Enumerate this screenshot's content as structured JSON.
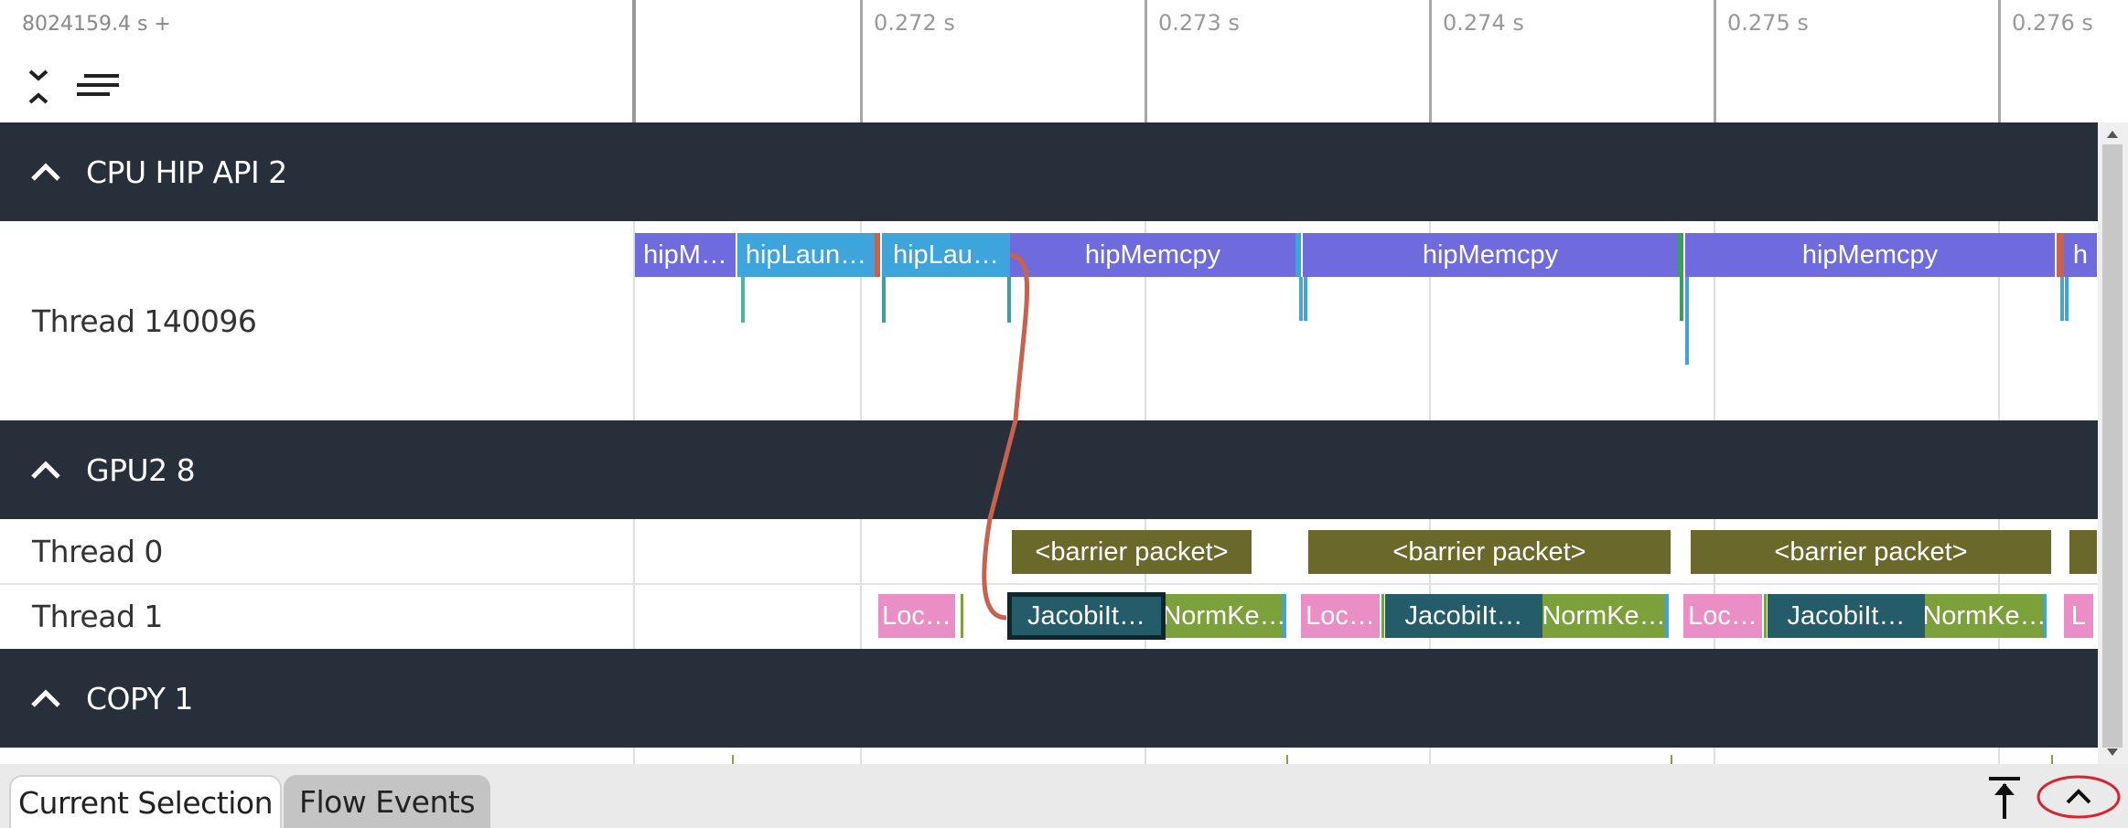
{
  "header": {
    "time_origin": "8024159.4 s +",
    "expand_collapse_icon": "expand-collapse-icon",
    "filter_icon": "lines-icon"
  },
  "ruler": {
    "ticks": [
      "0.272 s",
      "0.273 s",
      "0.274 s",
      "0.275 s",
      "0.276 s"
    ]
  },
  "groups": [
    {
      "title": "CPU HIP API 2",
      "icon": "chevron-up-icon"
    },
    {
      "title": "GPU2 8",
      "icon": "chevron-up-icon"
    },
    {
      "title": "COPY 1",
      "icon": "chevron-up-icon"
    }
  ],
  "tracks": {
    "cpu_thread": "Thread 140096",
    "gpu_thread0": "Thread 0",
    "gpu_thread1": "Thread 1"
  },
  "slices": {
    "api": [
      "hipM…",
      "hipLaun…",
      "hipLau…",
      "hipMemcpy",
      "hipMemcpy",
      "hipMemcpy",
      "h"
    ],
    "barrier": [
      "<barrier packet>",
      "<barrier packet>",
      "<barrier packet>"
    ],
    "kernels": [
      "Loc…",
      "JacobiIt…",
      "NormKe…",
      "Loc…",
      "JacobiIt…",
      "NormKe…",
      "Loc…",
      "JacobiIt…",
      "NormKe…",
      "L"
    ]
  },
  "bottom": {
    "tabs": [
      "Current Selection",
      "Flow Events"
    ],
    "pin_icon": "arrow-up-to-top-icon",
    "collapse_icon": "chevron-up-icon"
  },
  "colors": {
    "group_header": "#262f3a",
    "api_memcpy": "#6f6bde",
    "api_launch": "#3ea5dc",
    "barrier": "#6a692a",
    "jacobi": "#245c69",
    "norm": "#7ca13b",
    "local": "#e98fc6",
    "flow_arrow": "#c9614c",
    "annotation_circle": "#d9232e"
  }
}
